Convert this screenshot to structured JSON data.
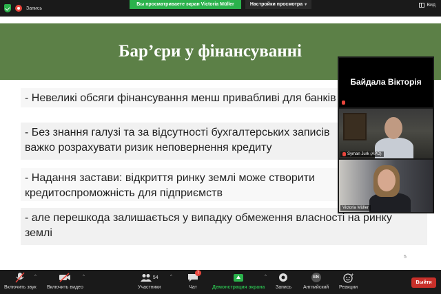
{
  "top_bar": {
    "recording_label": "Запись",
    "viewing_banner": "Вы просматриваете экран Victoria Müller",
    "view_settings_label": "Настройки просмотра",
    "view_label": "Вид"
  },
  "slide": {
    "title": "Бар’єри у фінансуванні",
    "bullets": [
      "- Невеликі обсяги фінансування менш привабливі для банків",
      "- Без знання галузі та за відсутності бухгалтерських записів",
      "важко розрахувати ризик неповернення кредиту",
      "- Надання застави: відкриття ринку землі може створити",
      "кредитоспроможність для підприємств",
      "- але перешкода залишається у випадку обмеження власності на ринку",
      "землі"
    ],
    "page_number": "5"
  },
  "participants_panel": {
    "tiles": [
      {
        "name": "Байдала Вікторія",
        "muted": true
      },
      {
        "name": "Syman Jurk (APD)",
        "muted": true
      },
      {
        "name": "Victoria Müller",
        "muted": false
      }
    ]
  },
  "toolbar": {
    "unmute_label": "Включить звук",
    "video_label": "Включить видео",
    "participants_label": "Участники",
    "participants_count": "54",
    "chat_label": "Чат",
    "chat_badge": "7",
    "share_label": "Демонстрация экрана",
    "record_label": "Запись",
    "language_label": "Английский",
    "language_code": "EN",
    "reactions_label": "Реакции",
    "leave_label": "Выйти"
  },
  "colors": {
    "slide_header": "#5c8047",
    "share_green": "#2bb24c",
    "leave_red": "#c8302a"
  }
}
